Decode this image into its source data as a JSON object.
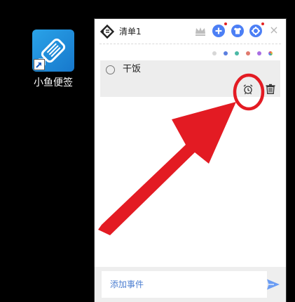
{
  "desktop": {
    "shortcut_label": "小鱼便签"
  },
  "window": {
    "list_title": "清单1",
    "close_glyph": "×"
  },
  "palette": {
    "colors": [
      "#d7d7d7",
      "#5b7fe0",
      "#4bb9a6",
      "#e07a6e",
      "#a96ee3"
    ]
  },
  "task": {
    "label": "干饭",
    "checked": false
  },
  "input": {
    "placeholder": "添加事件"
  },
  "colors": {
    "accent": "#4c7ff5",
    "annotation_red": "#e31b23",
    "task_background": "#ededed"
  },
  "icons": {
    "shortcut": "fish-app-icon",
    "shortcut_overlay": "shortcut-arrow-icon",
    "logo": "app-logo-icon",
    "crown": "crown-icon",
    "add": "plus-icon",
    "theme": "shirt-icon",
    "settings": "gear-icon",
    "reminder": "alarm-clock-icon",
    "delete": "trash-icon",
    "send": "paper-plane-icon"
  }
}
